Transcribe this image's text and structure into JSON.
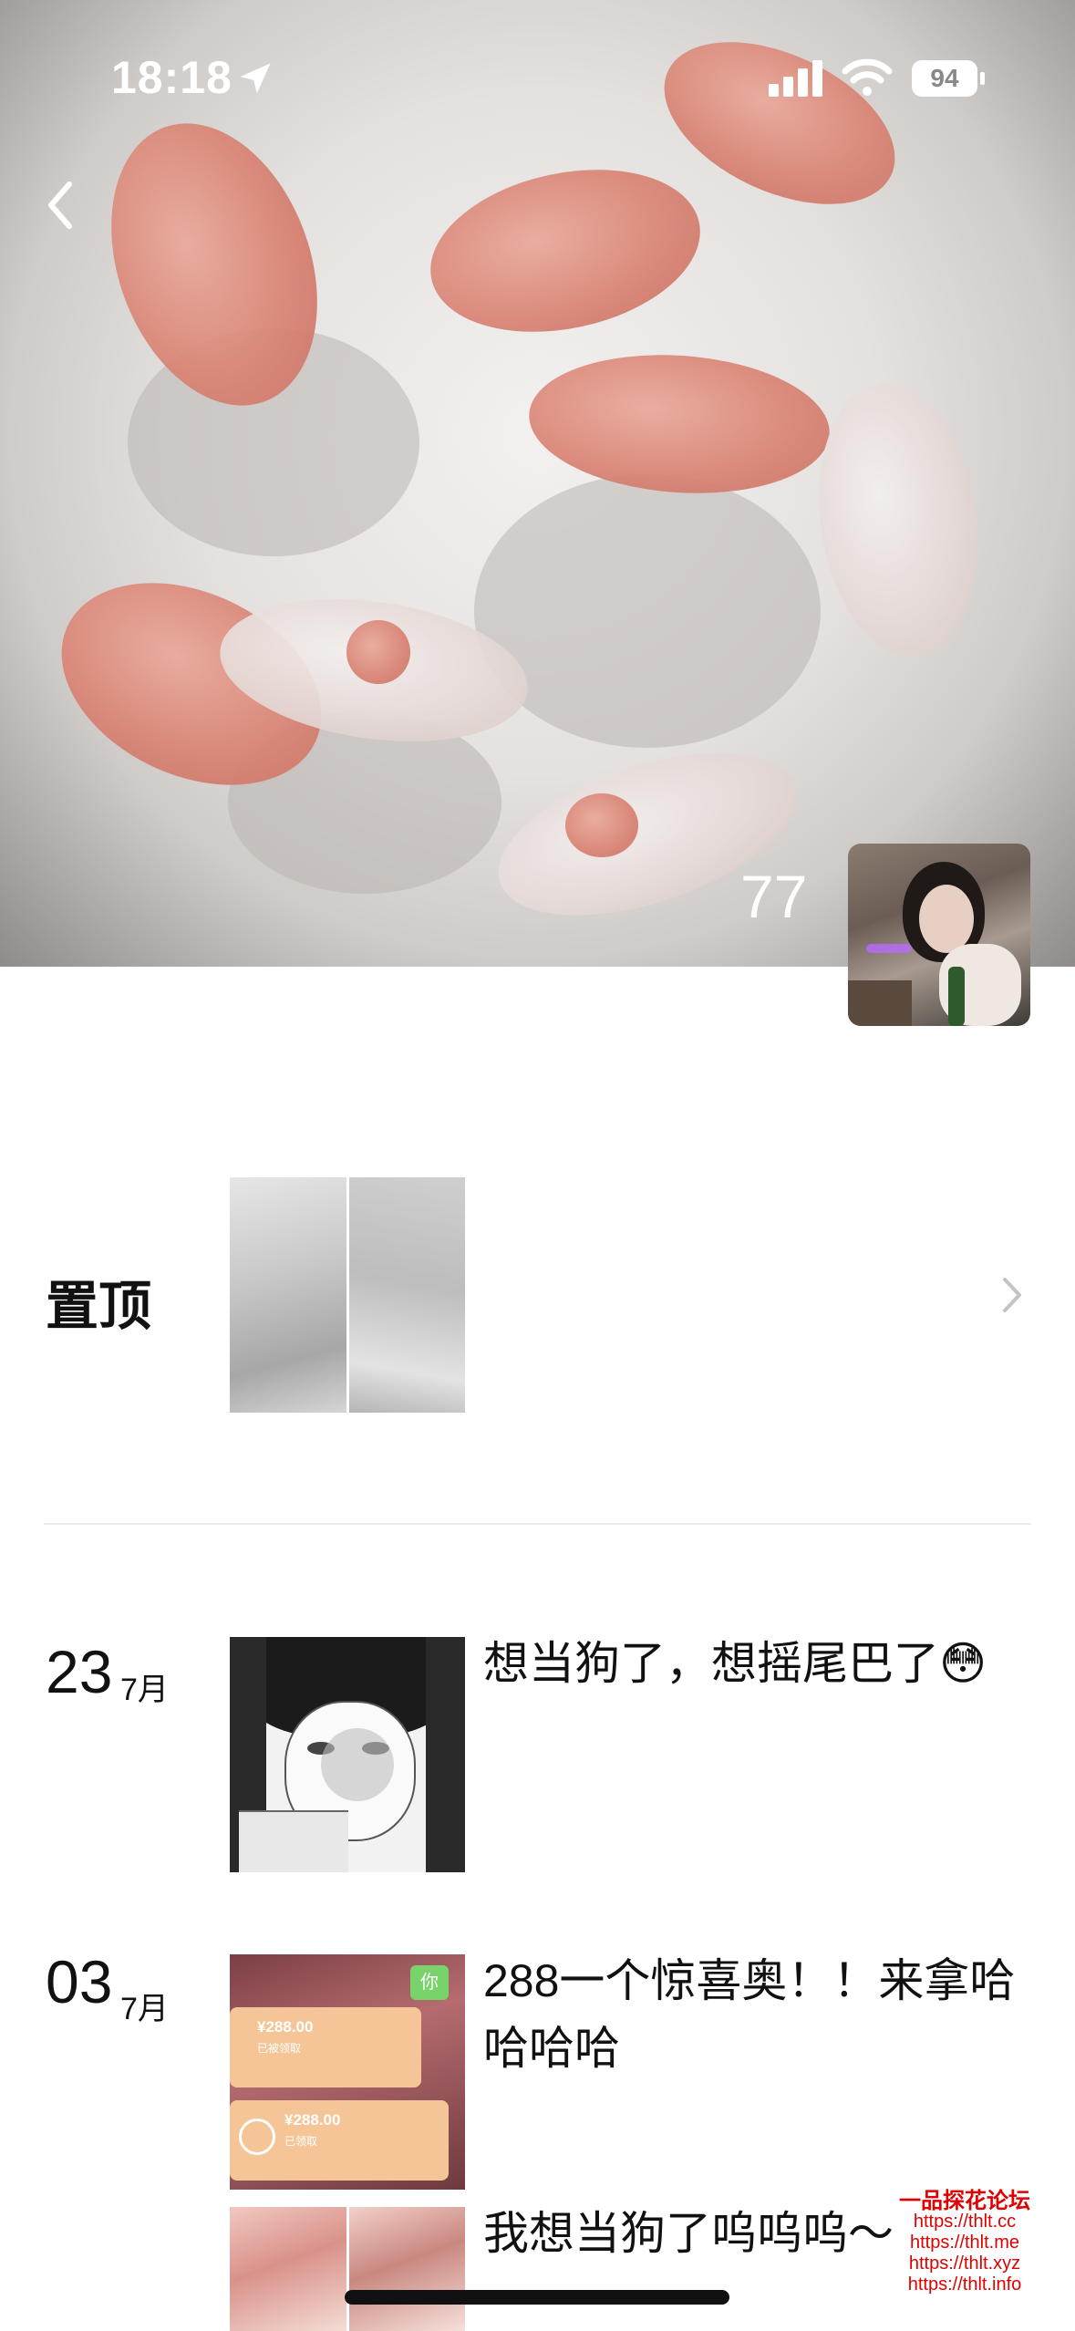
{
  "status_bar": {
    "time": "18:18",
    "battery": "94",
    "icons": [
      "location-arrow-icon",
      "signal-icon",
      "wifi-icon",
      "battery-icon"
    ]
  },
  "header": {
    "back_icon": "chevron-left-icon",
    "visitor_count": "77"
  },
  "pinned": {
    "label": "置顶",
    "chevron_icon": "chevron-right-icon"
  },
  "posts": [
    {
      "day": "23",
      "month": "7月",
      "text": "想当狗了，想摇尾巴了😳"
    },
    {
      "day": "03",
      "month": "7月",
      "text": "288一个惊喜奥！！来拿哈哈哈哈"
    },
    {
      "text": "我想当狗了呜呜呜～"
    }
  ],
  "thumb_text": {
    "amount1": "¥288.00",
    "status1": "已被领取",
    "amount2": "¥288.00",
    "status2": "已领取",
    "tag": "你"
  },
  "watermark": {
    "title": "一品探花论坛",
    "links": [
      "https://thlt.cc",
      "https://thlt.me",
      "https://thlt.xyz",
      "https://thlt.info"
    ]
  }
}
